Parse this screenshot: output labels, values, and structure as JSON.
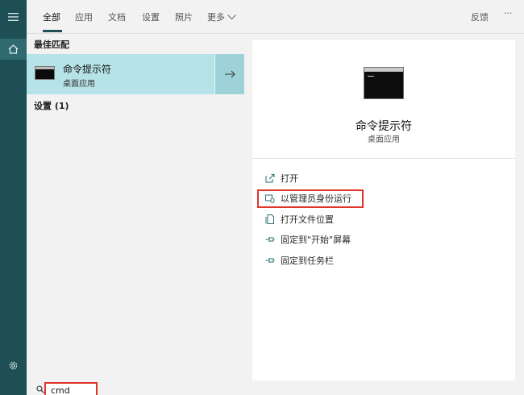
{
  "tabs": {
    "all": "全部",
    "apps": "应用",
    "documents": "文档",
    "settings": "设置",
    "photos": "照片",
    "more": "更多",
    "feedback": "反馈",
    "options": "···"
  },
  "left": {
    "best_match_label": "最佳匹配",
    "best_match": {
      "name": "命令提示符",
      "type": "桌面应用"
    },
    "settings_label": "设置 (1)"
  },
  "preview": {
    "name": "命令提示符",
    "type": "桌面应用"
  },
  "actions": [
    {
      "label": "打开"
    },
    {
      "label": "以管理员身份运行"
    },
    {
      "label": "打开文件位置"
    },
    {
      "label": "固定到\"开始\"屏幕"
    },
    {
      "label": "固定到任务栏"
    }
  ],
  "search": {
    "query": "cmd"
  },
  "colors": {
    "rail": "#1d4f55",
    "selected": "#b6e3e7",
    "highlight": "#e0342a"
  }
}
